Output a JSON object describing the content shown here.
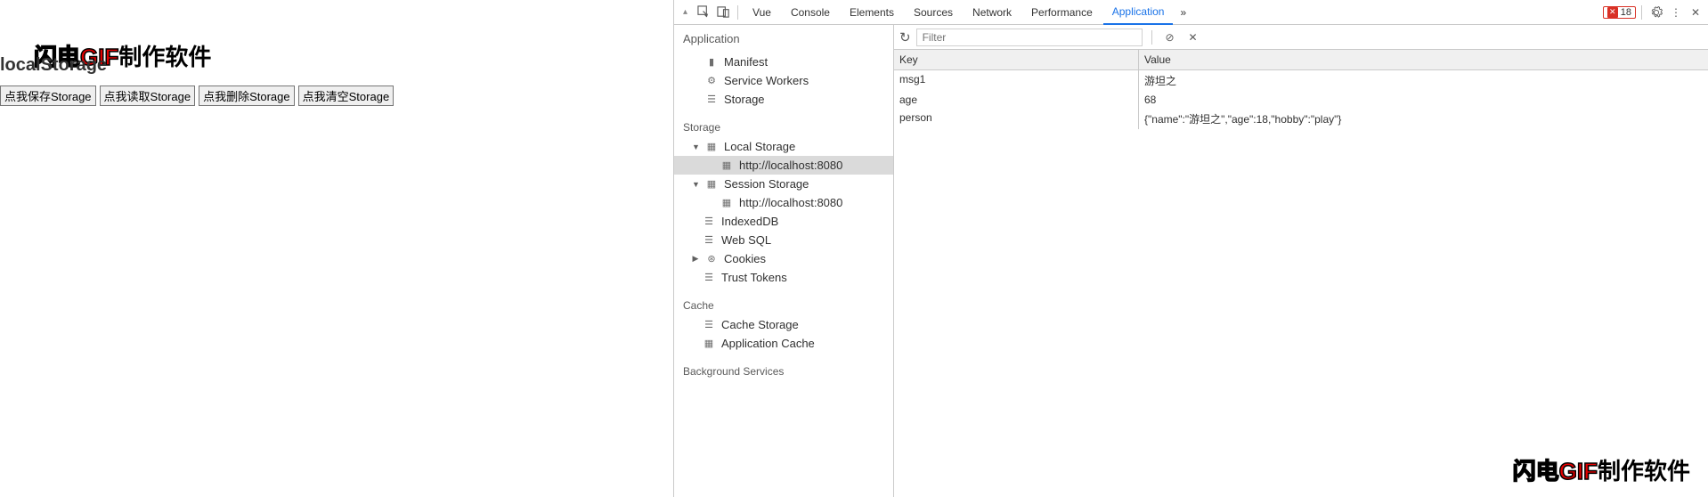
{
  "watermark": {
    "p1": "闪电",
    "p2": "GIF",
    "p3": "制作软件"
  },
  "page": {
    "heading": "localStorage",
    "buttons": [
      "点我保存Storage",
      "点我读取Storage",
      "点我删除Storage",
      "点我清空Storage"
    ]
  },
  "devtools": {
    "tabs": [
      "Vue",
      "Console",
      "Elements",
      "Sources",
      "Network",
      "Performance",
      "Application"
    ],
    "active_tab": "Application",
    "error_count": "18",
    "sidebar": {
      "title": "Application",
      "app_items": [
        "Manifest",
        "Service Workers",
        "Storage"
      ],
      "storage_label": "Storage",
      "storage": {
        "local": {
          "label": "Local Storage",
          "origin": "http://localhost:8080"
        },
        "session": {
          "label": "Session Storage",
          "origin": "http://localhost:8080"
        },
        "indexeddb": "IndexedDB",
        "websql": "Web SQL",
        "cookies": "Cookies",
        "trust": "Trust Tokens"
      },
      "cache_label": "Cache",
      "cache": {
        "storage": "Cache Storage",
        "appcache": "Application Cache"
      },
      "bg_label": "Background Services"
    },
    "filter_placeholder": "Filter",
    "table": {
      "key_label": "Key",
      "value_label": "Value",
      "rows": [
        {
          "k": "msg1",
          "v": "游坦之"
        },
        {
          "k": "age",
          "v": "68"
        },
        {
          "k": "person",
          "v": "{\"name\":\"游坦之\",\"age\":18,\"hobby\":\"play\"}"
        }
      ]
    }
  }
}
